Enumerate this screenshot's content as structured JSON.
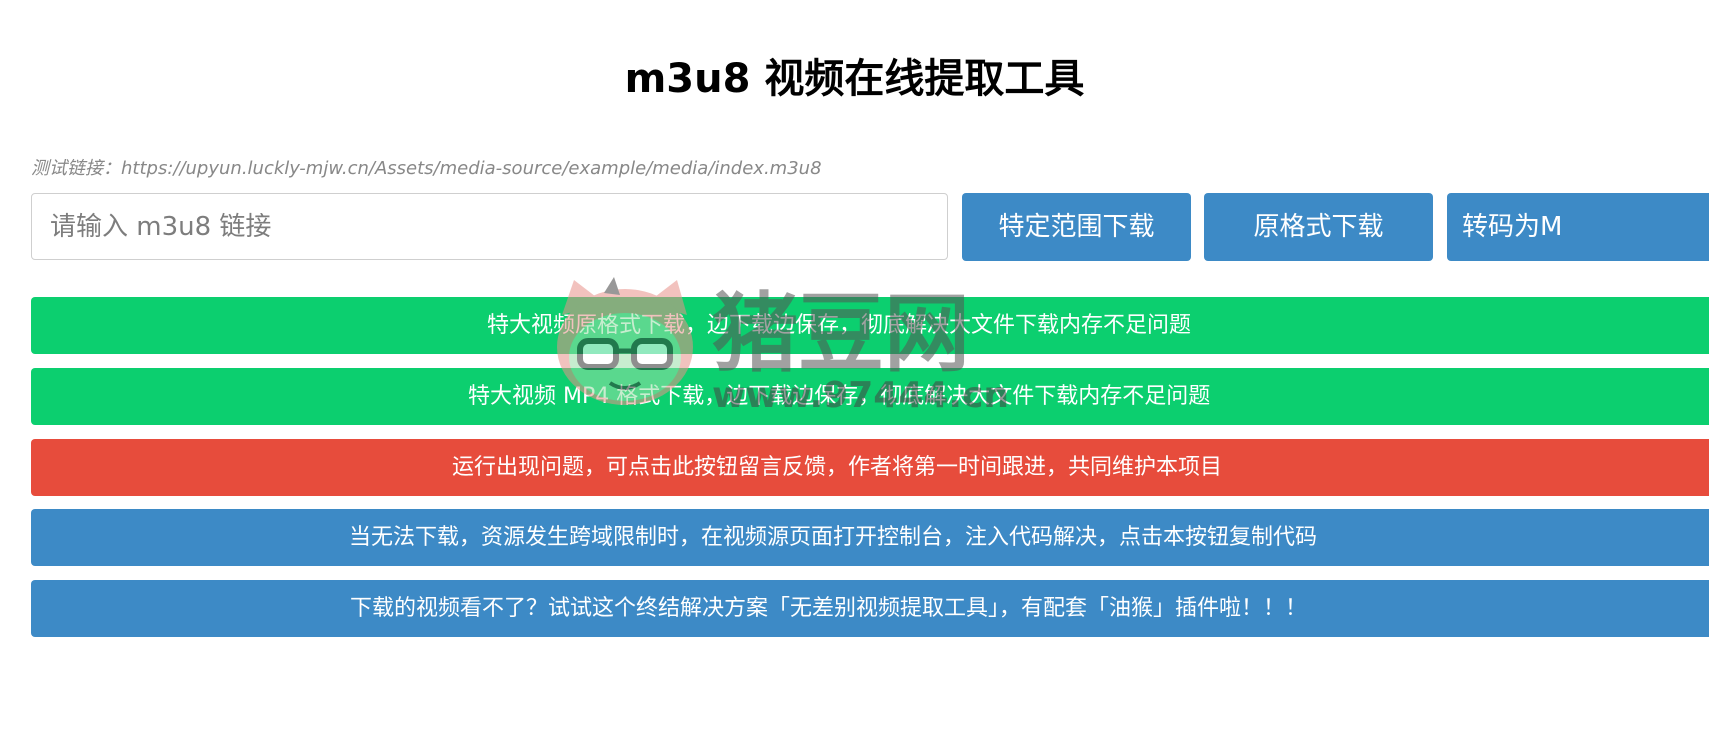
{
  "header": {
    "title": "m3u8 视频在线提取工具"
  },
  "test_link": {
    "text": "测试链接：https://upyun.luckly-mjw.cn/Assets/media-source/example/media/index.m3u8"
  },
  "url_input": {
    "placeholder": "请输入 m3u8 链接",
    "value": ""
  },
  "actions": {
    "range_download": "特定范围下载",
    "original_download": "原格式下载",
    "transcode_mp4": "转码为M"
  },
  "bars": [
    {
      "label": "特大视频原格式下载，边下载边保存，彻底解决大文件下载内存不足问题",
      "color": "#0ccf6f"
    },
    {
      "label": "特大视频 MP4 格式下载，边下载边保存，彻底解决大文件下载内存不足问题",
      "color": "#0ccf6f"
    },
    {
      "label": "运行出现问题，可点击此按钮留言反馈，作者将第一时间跟进，共同维护本项目",
      "color": "#e74c3c"
    },
    {
      "label": "当无法下载，资源发生跨域限制时，在视频源页面打开控制台，注入代码解决，点击本按钮复制代码",
      "color": "#3d8ac6"
    },
    {
      "label": "下载的视频看不了？试试这个终结解决方案「无差别视频提取工具」，有配套「油猴」插件啦！！！",
      "color": "#3d8ac6"
    }
  ],
  "watermark": {
    "text": "猪豆网",
    "url": "www.97444.cn",
    "icon": "cat-mascot-icon"
  },
  "colors": {
    "primary_blue": "#3d8ac6",
    "success_green": "#0ccf6f",
    "danger_red": "#e74c3c"
  }
}
